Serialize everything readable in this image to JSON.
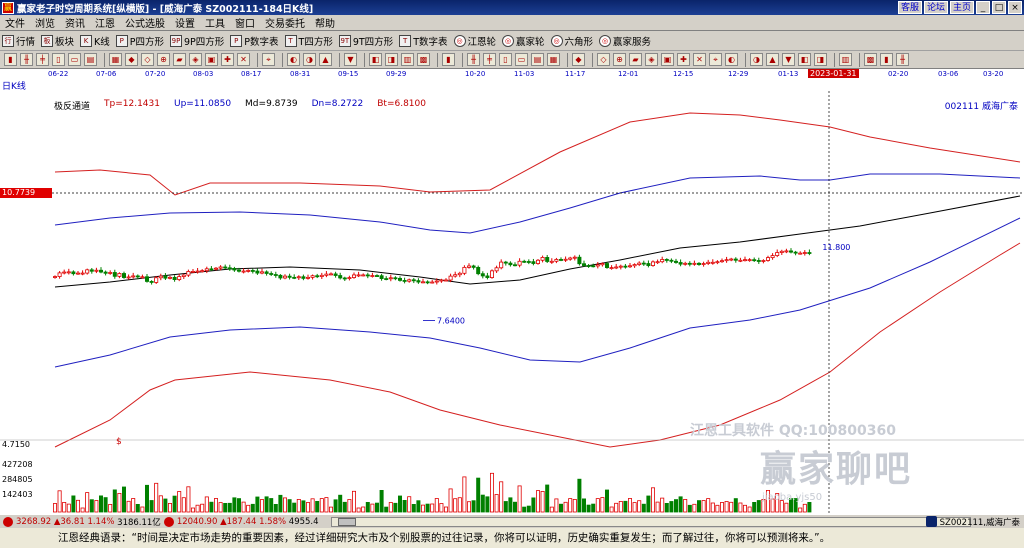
{
  "titlebar": {
    "title": "赢家老子时空周期系统[纵横版] - [威海广泰  SZ002111-184日K线]",
    "links": [
      "客服",
      "论坛",
      "主页"
    ],
    "window_buttons": [
      "_",
      "□",
      "×"
    ]
  },
  "menubar": [
    "文件",
    "浏览",
    "资讯",
    "江恩",
    "公式选股",
    "设置",
    "工具",
    "窗口",
    "交易委托",
    "帮助"
  ],
  "toolbar1": [
    {
      "icon": "行",
      "label": "行情"
    },
    {
      "icon": "板",
      "label": "板块"
    },
    {
      "icon": "K",
      "label": "K线"
    },
    {
      "icon": "P",
      "label": "P四方形"
    },
    {
      "icon": "9P",
      "label": "9P四方形"
    },
    {
      "icon": "P",
      "label": "P数字表"
    },
    {
      "icon": "T",
      "label": "T四方形"
    },
    {
      "icon": "9T",
      "label": "9T四方形"
    },
    {
      "icon": "T",
      "label": "T数字表"
    },
    {
      "icon": "◎",
      "label": "江恩轮",
      "round": true
    },
    {
      "icon": "◎",
      "label": "赢家轮",
      "round": true
    },
    {
      "icon": "◎",
      "label": "六角形",
      "round": true
    },
    {
      "icon": "◎",
      "label": "赢家服务",
      "round": true
    }
  ],
  "date_axis": {
    "period_label": "日K线",
    "dates": [
      "06-22",
      "07-06",
      "07-20",
      "08-03",
      "08-17",
      "08-31",
      "09-15",
      "09-29",
      "10-20",
      "11-03",
      "11-17",
      "12-01",
      "12-15",
      "12-29",
      "01-13",
      "02-20",
      "03-06",
      "03-20"
    ],
    "highlight": "2023-01-31"
  },
  "indicator": {
    "name": "极反通道",
    "tp": "Tp=12.1431",
    "up": "Up=11.0850",
    "md": "Md=9.8739",
    "dn": "Dn=8.2722",
    "bt": "Bt=6.8100"
  },
  "stock_name": "002111  威海广泰",
  "price_tag": "10.7739",
  "annotations": {
    "low": "7.6400",
    "high": "11.800"
  },
  "volume_axis": [
    "4.7150",
    "427208",
    "284805",
    "142403"
  ],
  "axis_marker": "$",
  "watermark": {
    "top": "江恩工具软件  QQ:100800360",
    "big": "赢家聊吧",
    "url": "jiaoba.yjs50"
  },
  "statusbar": {
    "sh_index": "3268.92",
    "sh_change": "▲36.81",
    "sh_pct": "1.14%",
    "sh_amount": "3186.11亿",
    "sz_index": "12040.90",
    "sz_change": "▲187.44",
    "sz_pct": "1.58%",
    "sz_amount": "4955.4",
    "stock": "SZ002111,威海广泰"
  },
  "quote": "江恩经典语录：“时间是决定市场走势的重要因素，经过详细研究大市及个别股票的过往记录，你将可以证明，历史确实重复发生；而了解过往，你将可以预测将来。”。",
  "colors": {
    "up_candle": "#e00000",
    "down_candle": "#008000",
    "tp_line": "#d42020",
    "up_line": "#2020c0",
    "md_line": "#000000"
  },
  "chart_data": {
    "type": "candlestick",
    "title": "",
    "closes": [
      9.8,
      9.98,
      10.02,
      10.03,
      9.94,
      9.97,
      9.97,
      10.13,
      10.06,
      10.11,
      10.02,
      9.96,
      10.0,
      9.81,
      9.95,
      9.75,
      9.78,
      9.83,
      9.79,
      9.79,
      9.56,
      9.51,
      9.74,
      9.82,
      9.72,
      9.76,
      9.65,
      9.8,
      9.87,
      10.05,
      10.05,
      10.07,
      10.09,
      10.18,
      10.16,
      10.21,
      10.27,
      10.23,
      10.2,
      10.12,
      10.06,
      10.07,
      10.1,
      10.07,
      9.97,
      10.03,
      9.95,
      9.9,
      9.86,
      9.73,
      9.82,
      9.76,
      9.75,
      9.79,
      9.71,
      9.76,
      9.84,
      9.8,
      9.86,
      9.92,
      9.93,
      9.85,
      9.73,
      9.7,
      9.75,
      9.88,
      9.88,
      9.88,
      9.84,
      9.85,
      9.84,
      9.7,
      9.69,
      9.74,
      9.71,
      9.61,
      9.57,
      9.64,
      9.6,
      9.53,
      9.54,
      9.53,
      9.53,
      9.58,
      9.63,
      9.63,
      9.82,
      9.89,
      9.96,
      10.25,
      10.32,
      10.25,
      9.94,
      9.83,
      9.75,
      10.08,
      10.23,
      10.51,
      10.46,
      10.38,
      10.36,
      10.55,
      10.54,
      10.53,
      10.44,
      10.6,
      10.74,
      10.54,
      10.55,
      10.64,
      10.62,
      10.65,
      10.71,
      10.75,
      10.43,
      10.34,
      10.33,
      10.32,
      10.38,
      10.44,
      10.24,
      10.24,
      10.27,
      10.31,
      10.28,
      10.33,
      10.39,
      10.46,
      10.44,
      10.34,
      10.52,
      10.53,
      10.64,
      10.6,
      10.55,
      10.49,
      10.41,
      10.45,
      10.42,
      10.45,
      10.39,
      10.44,
      10.5,
      10.5,
      10.53,
      10.58,
      10.63,
      10.66,
      10.6,
      10.6,
      10.63,
      10.63,
      10.59,
      10.54,
      10.59,
      10.73,
      10.83,
      10.98,
      11.04,
      11.06,
      11.0,
      10.95,
      10.95,
      10.98,
      10.94
    ]
  }
}
